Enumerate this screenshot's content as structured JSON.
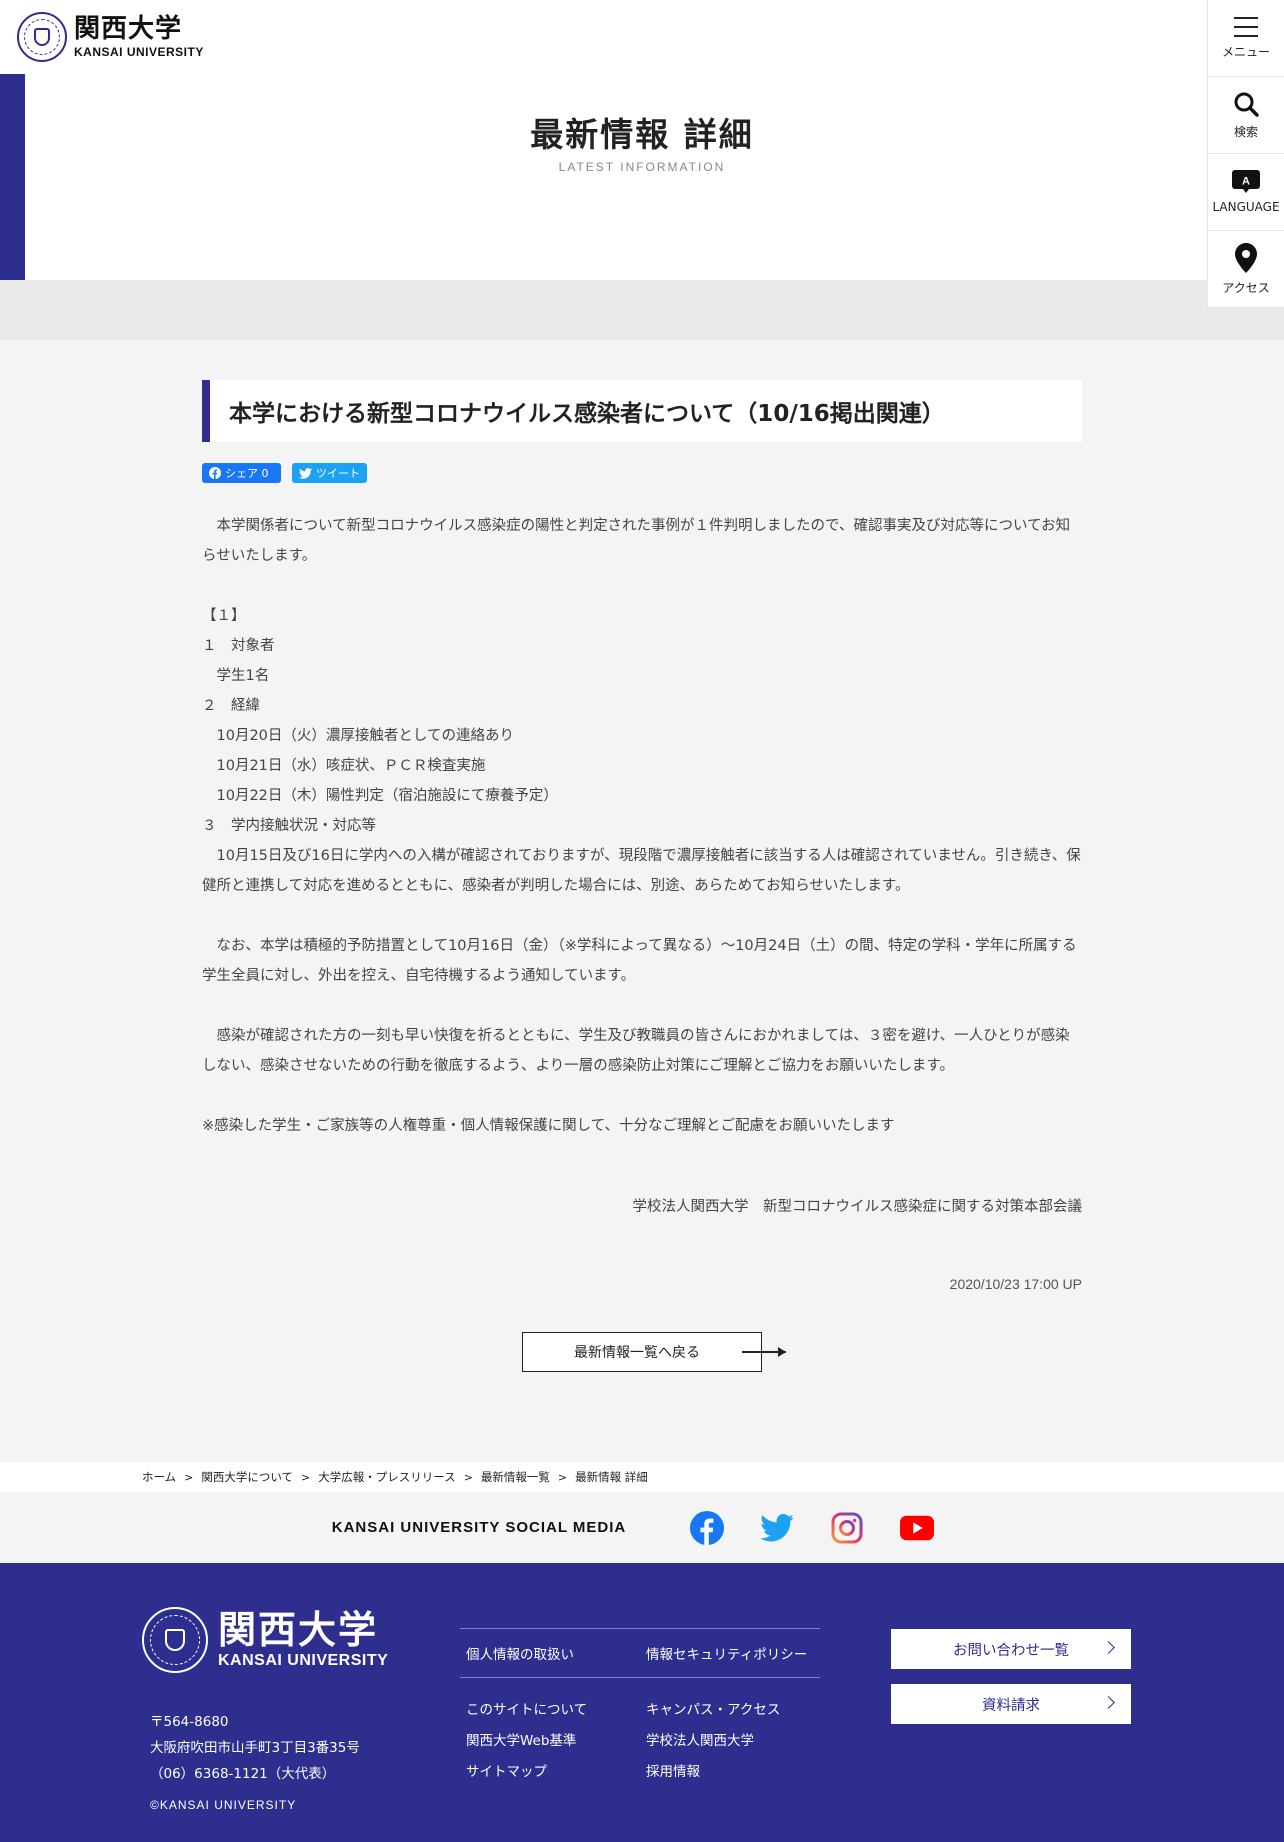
{
  "brand": {
    "name_jp": "関西大学",
    "name_en": "KANSAI UNIVERSITY",
    "accent": "#2e2e8f"
  },
  "util_nav": {
    "menu": "メニュー",
    "search": "検索",
    "language_badge": "A",
    "language": "LANGUAGE",
    "access": "アクセス"
  },
  "header": {
    "title": "最新情報 詳細",
    "subtitle": "LATEST INFORMATION"
  },
  "article": {
    "title": "本学における新型コロナウイルス感染者について（10/16掲出関連）",
    "share_facebook": "シェア 0",
    "share_twitter": "ツイート",
    "paragraphs": [
      "　本学関係者について新型コロナウイルス感染症の陽性と判定された事例が１件判明しましたので、確認事実及び対応等についてお知らせいたします。",
      "",
      "【１】",
      "１　対象者",
      "　学生1名",
      "２　経緯",
      "　10月20日（火）濃厚接触者としての連絡あり",
      "　10月21日（水）咳症状、ＰＣＲ検査実施",
      "　10月22日（木）陽性判定（宿泊施設にて療養予定）",
      "３　学内接触状況・対応等",
      "　10月15日及び16日に学内への入構が確認されておりますが、現段階で濃厚接触者に該当する人は確認されていません。引き続き、保健所と連携して対応を進めるとともに、感染者が判明した場合には、別途、あらためてお知らせいたします。",
      "",
      "　なお、本学は積極的予防措置として10月16日（金）（※学科によって異なる）～10月24日（土）の間、特定の学科・学年に所属する学生全員に対し、外出を控え、自宅待機するよう通知しています。",
      "",
      "　感染が確認された方の一刻も早い快復を祈るとともに、学生及び教職員の皆さんにおかれましては、３密を避け、一人ひとりが感染しない、感染させないための行動を徹底するよう、より一層の感染防止対策にご理解とご協力をお願いいたします。",
      "",
      "※感染した学生・ご家族等の人権尊重・個人情報保護に関して、十分なご理解とご配慮をお願いいたします"
    ],
    "signature": "学校法人関西大学　新型コロナウイルス感染症に関する対策本部会議",
    "date": "2020/10/23 17:00 UP",
    "back_label": "最新情報一覧へ戻る"
  },
  "breadcrumb": {
    "items": [
      "ホーム",
      "関西大学について",
      "大学広報・プレスリリース",
      "最新情報一覧",
      "最新情報 詳細"
    ],
    "separator": ">"
  },
  "social": {
    "label": "KANSAI UNIVERSITY SOCIAL MEDIA",
    "icons": [
      "facebook-icon",
      "twitter-icon",
      "instagram-icon",
      "youtube-icon"
    ],
    "colors": {
      "facebook": "#1877f2",
      "twitter": "#1da1f2",
      "youtube": "#ff0000"
    }
  },
  "footer": {
    "postal": "〒564-8680",
    "address": "大阪府吹田市山手町3丁目3番35号",
    "phone": "（06）6368-1121（大代表）",
    "copyright": "©KANSAI UNIVERSITY",
    "links_top": [
      "個人情報の取扱い",
      "情報セキュリティポリシー"
    ],
    "links_bottom": [
      "このサイトについて",
      "キャンパス・アクセス",
      "関西大学Web基準",
      "学校法人関西大学",
      "サイトマップ",
      "採用情報"
    ],
    "contact_button": "お問い合わせ一覧",
    "request_button": "資料請求"
  }
}
